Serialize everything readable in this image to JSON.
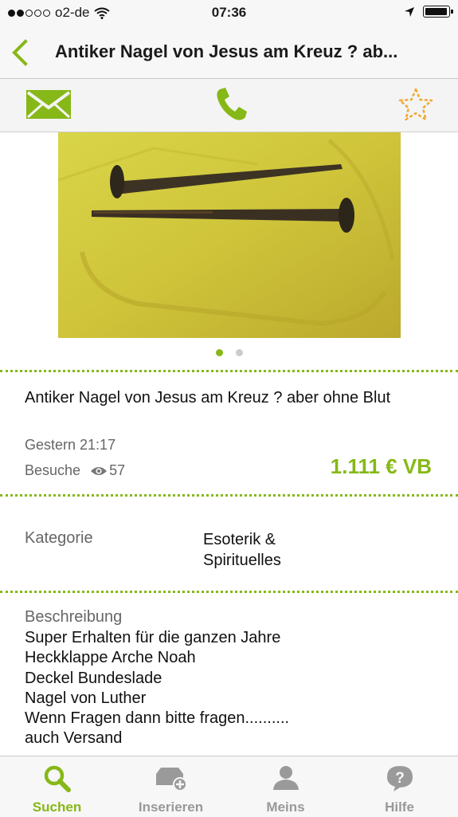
{
  "status_bar": {
    "carrier": "o2-de",
    "time": "07:36"
  },
  "nav": {
    "title": "Antiker Nagel  von Jesus am  Kreuz ? ab..."
  },
  "actions": {
    "message_icon": "envelope-icon",
    "call_icon": "phone-icon",
    "favorite_icon": "star-outline-icon"
  },
  "gallery": {
    "page_count": 2,
    "current_page": 1
  },
  "ad": {
    "title": "Antiker Nagel  von Jesus am  Kreuz ? aber ohne Blut",
    "date": "Gestern 21:17",
    "visits_label": "Besuche",
    "visits_count": "57",
    "price": "1.111 € VB"
  },
  "category": {
    "label": "Kategorie",
    "value": "Esoterik & Spirituelles"
  },
  "description": {
    "label": "Beschreibung",
    "lines": [
      "Super Erhalten für die ganzen Jahre",
      "Heckklappe Arche Noah",
      "Deckel Bundeslade",
      "Nagel von Luther",
      "Wenn Fragen dann bitte fragen..........",
      "auch Versand"
    ]
  },
  "tabs": [
    {
      "label": "Suchen",
      "icon": "search-icon",
      "active": true
    },
    {
      "label": "Inserieren",
      "icon": "add-listing-icon",
      "active": false
    },
    {
      "label": "Meins",
      "icon": "user-icon",
      "active": false
    },
    {
      "label": "Hilfe",
      "icon": "help-icon",
      "active": false
    }
  ],
  "colors": {
    "accent": "#86b817",
    "favorite": "#f0a830",
    "muted": "#999999"
  }
}
